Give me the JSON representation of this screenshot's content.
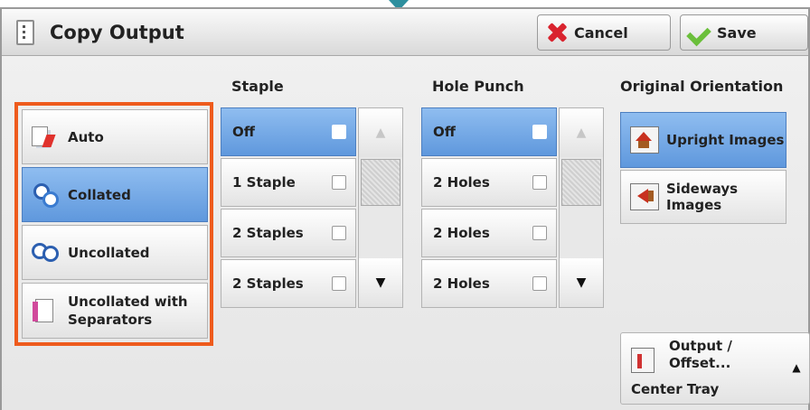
{
  "header": {
    "title": "Copy Output",
    "cancel_label": "Cancel",
    "save_label": "Save"
  },
  "output_options": [
    {
      "label": "Auto",
      "icon": "auto-sort-icon",
      "selected": false
    },
    {
      "label": "Collated",
      "icon": "collated-icon",
      "selected": true
    },
    {
      "label": "Uncollated",
      "icon": "uncollated-icon",
      "selected": false
    },
    {
      "label_line1": "Uncollated with",
      "label_line2": "Separators",
      "icon": "separators-icon",
      "selected": false
    }
  ],
  "staple": {
    "heading": "Staple",
    "items": [
      "Off",
      "1 Staple",
      "2 Staples",
      "2 Staples"
    ],
    "selected_index": 0
  },
  "hole_punch": {
    "heading": "Hole Punch",
    "items": [
      "Off",
      "2 Holes",
      "2 Holes",
      "2 Holes"
    ],
    "selected_index": 0
  },
  "orientation": {
    "heading": "Original Orientation",
    "upright_label": "Upright Images",
    "sideways_line1": "Sideways",
    "sideways_line2": "Images",
    "selected": "upright"
  },
  "output_offset": {
    "label_line1": "Output /",
    "label_line2": "Offset...",
    "value": "Center Tray"
  },
  "colors": {
    "selection": "#6fa6e6",
    "highlight_border": "#ee5b1d",
    "indicator": "#2e8f9e"
  }
}
